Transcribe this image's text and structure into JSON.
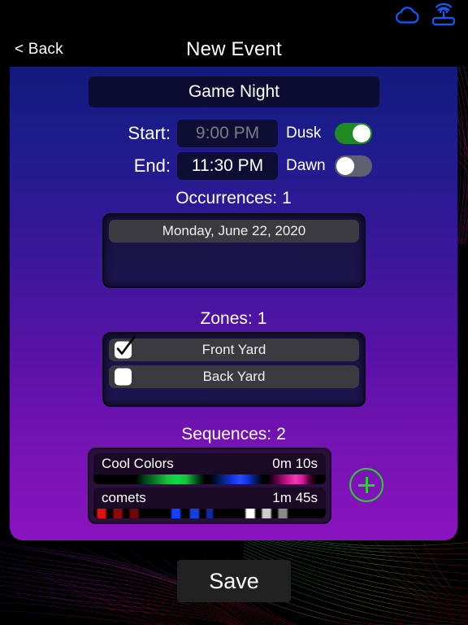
{
  "statusbar": {
    "icons": [
      {
        "name": "cloud-icon",
        "label": "cloud"
      },
      {
        "name": "router-wifi-icon",
        "label": "router"
      }
    ],
    "icon_color": "#0a5cff"
  },
  "navbar": {
    "back_label": "< Back",
    "title": "New Event"
  },
  "form": {
    "event_name": "Game Night",
    "event_name_placeholder": "Event Name",
    "start": {
      "label": "Start:",
      "value": "9:00 PM",
      "disabled": true,
      "toggle_label": "Dusk",
      "toggle_on": true
    },
    "end": {
      "label": "End:",
      "value": "11:30 PM",
      "disabled": false,
      "toggle_label": "Dawn",
      "toggle_on": false
    }
  },
  "occurrences": {
    "heading": "Occurrences:",
    "count": "1",
    "items": [
      {
        "label": "Monday, June 22, 2020"
      }
    ]
  },
  "zones": {
    "heading": "Zones:",
    "count": "1",
    "items": [
      {
        "label": "Front Yard",
        "checked": true
      },
      {
        "label": "Back Yard",
        "checked": false
      }
    ]
  },
  "sequences": {
    "heading": "Sequences:",
    "count": "2",
    "add_label": "+",
    "items": [
      {
        "name": "Cool Colors",
        "duration": "0m 10s",
        "gradient": "cool-colors"
      },
      {
        "name": "comets",
        "duration": "1m 45s",
        "gradient": "comets"
      }
    ]
  },
  "footer": {
    "save_label": "Save"
  },
  "colors": {
    "accent_blue": "#0a5cff",
    "toggle_on": "#1f8a21",
    "toggle_off": "#5e6270",
    "add_green": "#2bd22b",
    "panel_top": "#121a7a",
    "panel_bottom": "#8a13bf",
    "save_bg": "#212121"
  }
}
